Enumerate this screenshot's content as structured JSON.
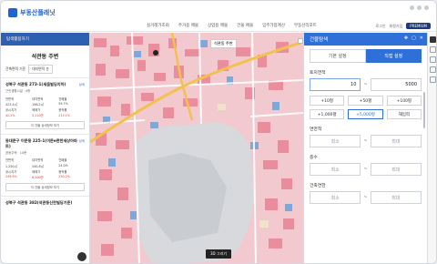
{
  "app": {
    "logo": "부동산플래닛"
  },
  "topnav": [
    "실거래가조회",
    "주거용 매물",
    "상업용 매물",
    "건물 매물",
    "임주가점계산",
    "부동산리포트"
  ],
  "topright": {
    "login": "로그인",
    "signup": "회원가입",
    "premium": "PREMIUM"
  },
  "sidebar": {
    "header": "탐색활용하기",
    "title": "석관동 주변",
    "filter": {
      "label": "건축면적 기준",
      "select": "대지면적 순"
    },
    "cards": [
      {
        "title": "성북구 석관동 273-1(세움빌딩지하)",
        "sub": "근린생활시설 · 4층",
        "link": "상세",
        "rows": [
          [
            "연면적",
            "대지면적",
            "건폐율"
          ],
          [
            "423.4㎡",
            "196.2㎡",
            "59.7%"
          ],
          [
            "공시지가",
            "매매가",
            "용적률"
          ],
          [
            "42.2%",
            "5,210만",
            "215.1%"
          ]
        ],
        "button": "이 건물 상세정보 보기"
      },
      {
        "title": "동대문구 이문동 225-1(이문e편한세상아파트)",
        "sub": "공동주택 · 14층",
        "link": "상세",
        "rows": [
          [
            "연면적",
            "대지면적",
            "건폐율"
          ],
          [
            "1,250㎡",
            "540.8㎡",
            "24.0%"
          ],
          [
            "공시지가",
            "매매가",
            "용적률"
          ],
          [
            "249.9%",
            "6,200만",
            "230.2%"
          ]
        ],
        "button": "이 건물 상세정보 보기"
      },
      {
        "title": "성북구 석관동 382(석관동신한빌딩기준)",
        "sub": "",
        "link": "",
        "rows": [],
        "button": ""
      }
    ]
  },
  "map": {
    "label": "석관동 주변",
    "view_button": "3D 그리기"
  },
  "panel": {
    "title": "건물탐색",
    "tabs": [
      "기본 설정",
      "직접 설정"
    ],
    "land_area": {
      "label": "토지면적",
      "min": "10",
      "max": "5000"
    },
    "quick_buttons": [
      "+10평",
      "+50평",
      "+100평",
      "+1,000평",
      "+5,000평",
      "재입력"
    ],
    "floor_area": {
      "label": "연면적",
      "min": "최소",
      "max": "최대"
    },
    "floors": {
      "label": "층수",
      "min": "최소",
      "max": "최대"
    },
    "year": {
      "label": "건축연한",
      "min": "최소",
      "max": "최대"
    }
  }
}
